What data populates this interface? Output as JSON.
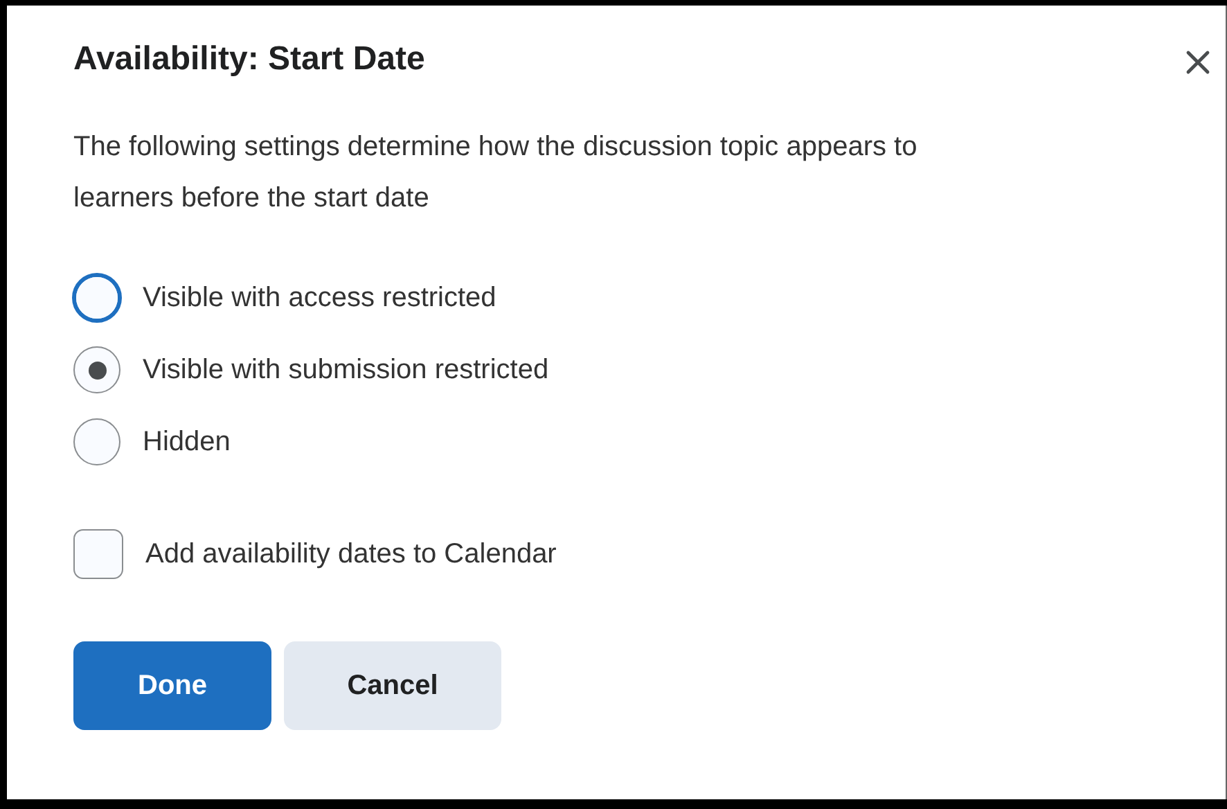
{
  "dialog": {
    "title": "Availability: Start Date",
    "description": "The following settings determine how the discussion topic appears to learners before the start date",
    "options": [
      {
        "label": "Visible with access restricted",
        "selected": false,
        "focused": true
      },
      {
        "label": "Visible with submission restricted",
        "selected": true,
        "focused": false
      },
      {
        "label": "Hidden",
        "selected": false,
        "focused": false
      }
    ],
    "calendar_checkbox": {
      "label": "Add availability dates to Calendar",
      "checked": false
    },
    "buttons": [
      {
        "label": "Done",
        "kind": "primary"
      },
      {
        "label": "Cancel",
        "kind": "secondary"
      }
    ]
  }
}
